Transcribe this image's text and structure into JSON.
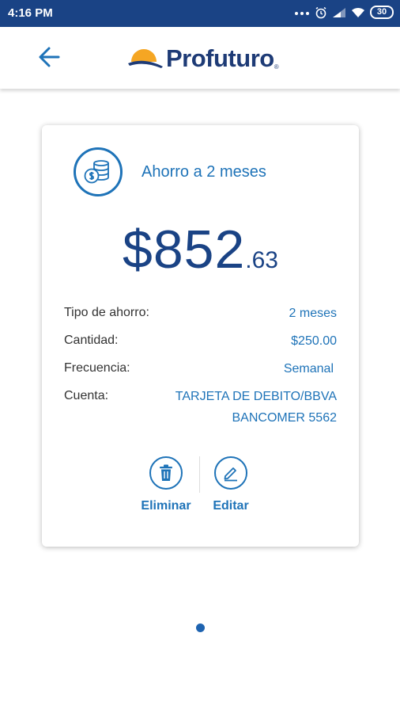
{
  "status_bar": {
    "time": "4:16 PM",
    "battery": "30"
  },
  "app_bar": {
    "brand": "Profuturo"
  },
  "card": {
    "title": "Ahorro a 2 meses",
    "amount_integer": "$852",
    "amount_decimal": ".63",
    "details": [
      {
        "label": "Tipo de ahorro:",
        "value": "2 meses"
      },
      {
        "label": "Cantidad:",
        "value": "$250.00"
      },
      {
        "label": "Frecuencia:",
        "value": "Semanal"
      },
      {
        "label": "Cuenta:",
        "value": "TARJETA DE DEBITO/BBVA\nBANCOMER 5562"
      }
    ],
    "actions": {
      "delete_label": "Eliminar",
      "edit_label": "Editar"
    }
  },
  "colors": {
    "primary": "#1a4385",
    "accent": "#1e73b8",
    "logo_sun": "#f5a623"
  },
  "icons": [
    "back-arrow",
    "coins",
    "trash",
    "pencil"
  ]
}
